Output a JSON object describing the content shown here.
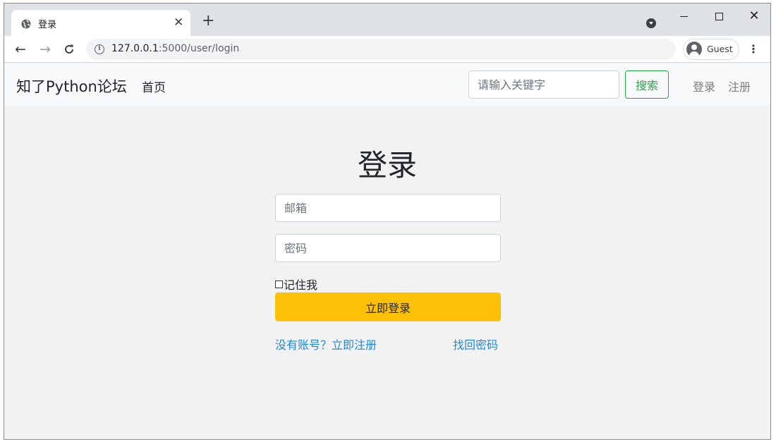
{
  "browser": {
    "tab_title": "登录",
    "new_tab_symbol": "+",
    "url_host": "127.0.0.1",
    "url_path": ":5000/user/login",
    "profile_name": "Guest"
  },
  "navbar": {
    "brand": "知了Python论坛",
    "home_label": "首页",
    "search_placeholder": "请输入关键字",
    "search_button_label": "搜索",
    "login_label": "登录",
    "register_label": "注册",
    "accent_color": "#28a745"
  },
  "form": {
    "title": "登录",
    "email_placeholder": "邮箱",
    "password_placeholder": "密码",
    "remember_label": "记住我",
    "remember_checked": false,
    "submit_label": "立即登录",
    "submit_color": "#ffc107",
    "register_link_label": "没有账号？立即注册",
    "forgot_link_label": "找回密码",
    "link_color": "#1e88e5"
  },
  "icons": {
    "tab_favicon": "globe-icon",
    "tab_close": "close-icon",
    "back": "arrow-left-icon",
    "forward": "arrow-right-icon",
    "reload": "reload-icon",
    "site_info": "info-icon",
    "profile": "account-circle-icon",
    "menu": "kebab-menu-icon"
  }
}
